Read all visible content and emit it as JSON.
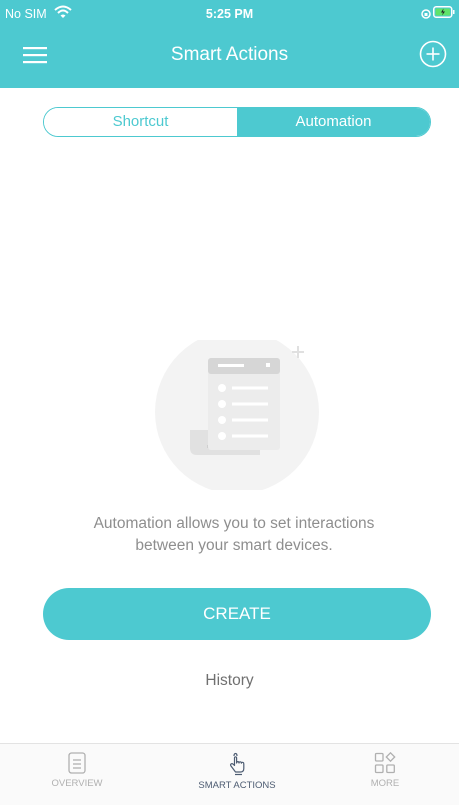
{
  "status_bar": {
    "carrier": "No SIM",
    "time": "5:25 PM"
  },
  "nav": {
    "title": "Smart Actions"
  },
  "segments": {
    "shortcut": "Shortcut",
    "automation": "Automation"
  },
  "empty_state": {
    "line1": "Automation allows you to set interactions",
    "line2": "between your smart devices."
  },
  "buttons": {
    "create": "CREATE",
    "history": "History"
  },
  "tabbar": {
    "overview": "OVERVIEW",
    "smart_actions": "SMART ACTIONS",
    "more": "MORE"
  },
  "colors": {
    "accent": "#4dc9d0",
    "active_tab": "#4d5c72",
    "inactive_tab": "#b0b0b0",
    "text_gray": "#8e8e8e"
  }
}
